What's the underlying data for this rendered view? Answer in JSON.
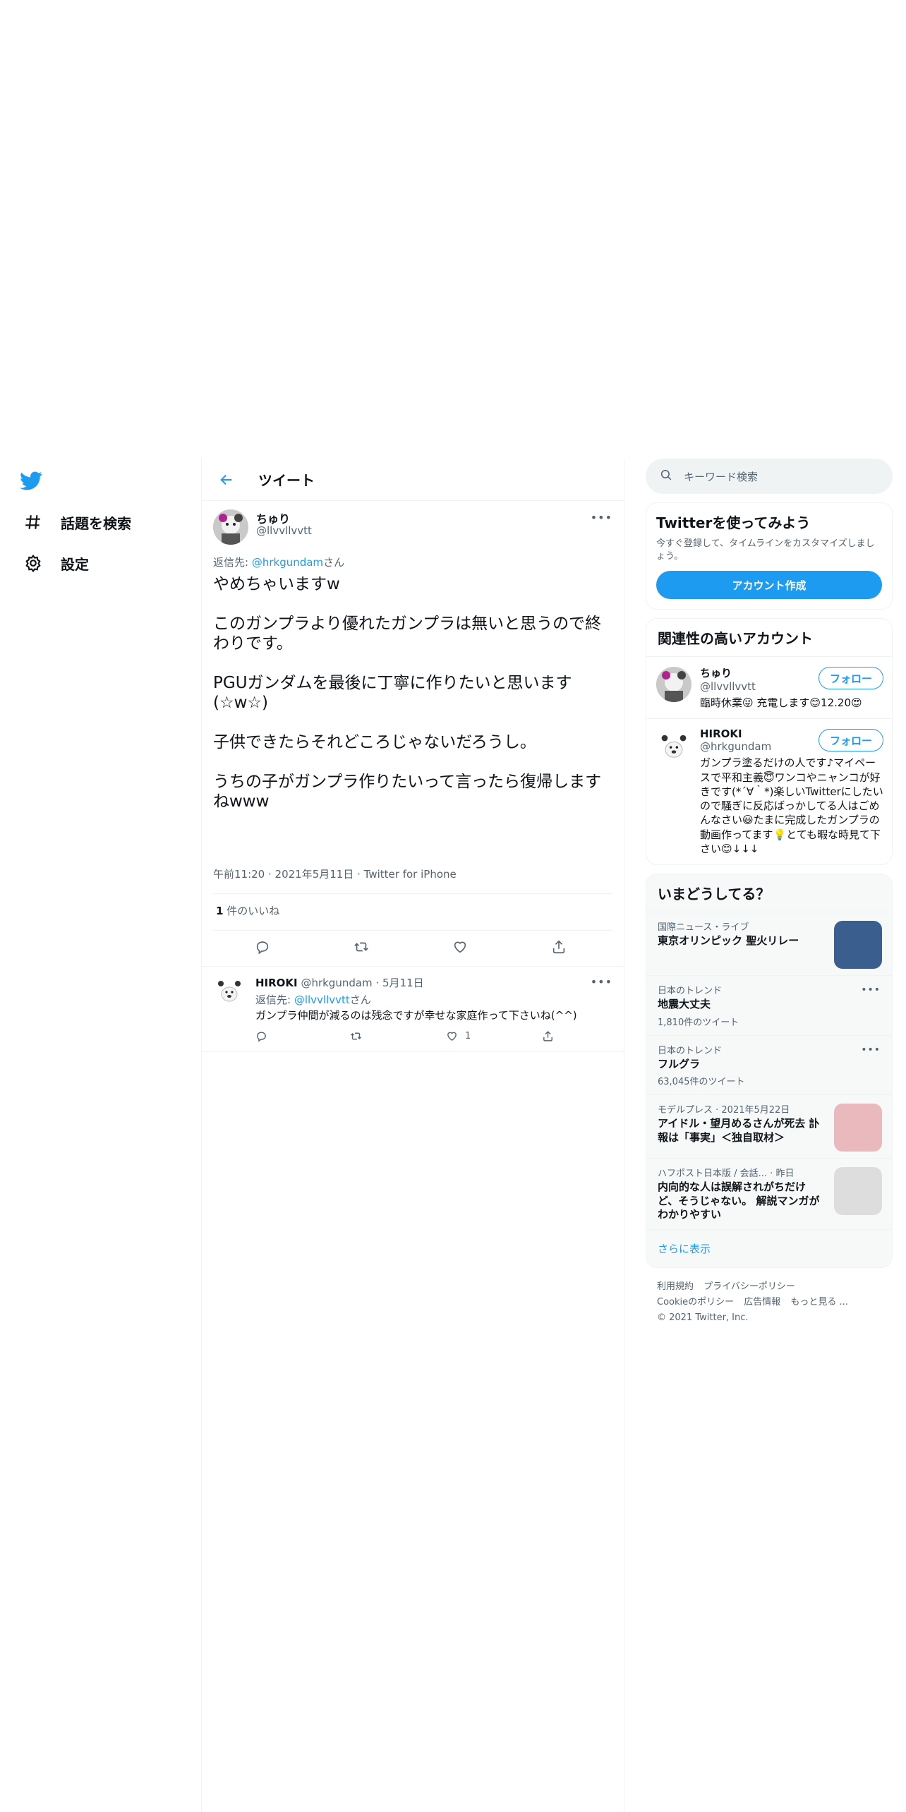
{
  "nav": {
    "items": [
      {
        "label": "話題を検索",
        "icon": "hashtag-icon"
      },
      {
        "label": "設定",
        "icon": "gear-icon"
      }
    ]
  },
  "header": {
    "title": "ツイート"
  },
  "main_tweet": {
    "author_name": "ちゅり",
    "author_handle": "@llvvllvvtt",
    "reply_prefix": "返信先: ",
    "reply_to": "@hrkgundam",
    "reply_suffix": "さん",
    "paragraphs": [
      "やめちゃいますw",
      "このガンプラより優れたガンプラは無いと思うので終わりです。",
      "PGUガンダムを最後に丁寧に作りたいと思います(☆w☆)",
      "子供できたらそれどころじゃないだろうし。",
      "うちの子がガンプラ作りたいって言ったら復帰しますねwww"
    ],
    "time": "午前11:20",
    "date": "2021年5月11日",
    "source": "Twitter for iPhone",
    "like_count": "1",
    "like_label": " 件のいいね"
  },
  "reply_tweet": {
    "author_name": "HIROKI",
    "author_handle": "@hrkgundam",
    "date": "5月11日",
    "reply_prefix": "返信先: ",
    "reply_to": "@llvvllvvtt",
    "reply_suffix": "さん",
    "text": "ガンプラ仲間が減るのは残念ですが幸せな家庭作って下さいね(^^)",
    "like_count": "1"
  },
  "search": {
    "placeholder": "キーワード検索"
  },
  "signup": {
    "title": "Twitterを使ってみよう",
    "description": "今すぐ登録して、タイムラインをカスタマイズしましょう。",
    "button": "アカウント作成"
  },
  "related": {
    "title": "関連性の高いアカウント",
    "follow_label": "フォロー",
    "accounts": [
      {
        "name": "ちゅり",
        "handle": "@llvvllvvtt",
        "bio": "臨時休業😜 充電します😊12.20😍"
      },
      {
        "name": "HIROKI",
        "handle": "@hrkgundam",
        "bio": "ガンプラ塗るだけの人です♪マイペースで平和主義😇ワンコやニャンコが好きです(*´∀｀*)楽しいTwitterにしたいので騒ぎに反応ばっかしてる人はごめんなさい😃たまに完成したガンプラの動画作ってます💡とても暇な時見て下さい😊↓↓↓"
      }
    ]
  },
  "trends": {
    "title": "いまどうしてる？",
    "items": [
      {
        "context": "国際ニュース・ライブ",
        "title": "東京オリンピック 聖火リレー",
        "count": "",
        "thumb_color": "#3a5f8f"
      },
      {
        "context": "日本のトレンド",
        "title": "地震大丈夫",
        "count": "1,810件のツイート"
      },
      {
        "context": "日本のトレンド",
        "title": "フルグラ",
        "count": "63,045件のツイート"
      },
      {
        "context": "モデルプレス · 2021年5月22日",
        "title": "アイドル・望月めるさんが死去 訃報は「事実」＜独自取材＞",
        "count": "",
        "thumb_color": "#e9b9bd"
      },
      {
        "context": "ハフポスト日本版 / 会話... · 昨日",
        "title": "内向的な人は誤解されがちだけど、そうじゃない。 解説マンガがわかりやすい",
        "count": "",
        "thumb_color": "#dddddd"
      }
    ],
    "show_more": "さらに表示"
  },
  "footer": {
    "links": [
      "利用規約",
      "プライバシーポリシー",
      "Cookieのポリシー",
      "広告情報",
      "もっと見る ..."
    ],
    "copyright": "© 2021 Twitter, Inc."
  },
  "colors": {
    "accent": "#1d9bf0",
    "text": "#0f1419",
    "muted": "#536471",
    "border": "#eff3f4"
  }
}
